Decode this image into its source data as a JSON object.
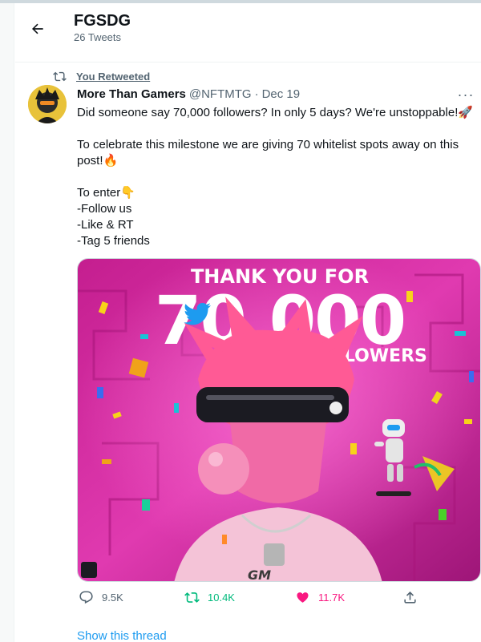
{
  "header": {
    "name": "FGSDG",
    "tweet_count": "26 Tweets"
  },
  "tweet": {
    "retweet_label": "You Retweeted",
    "author_name": "More Than Gamers",
    "author_handle": "@NFTMTG",
    "separator": "·",
    "date": "Dec 19",
    "more_label": "···",
    "text_lines": [
      "Did someone say 70,000 followers? In only 5 days? We're unstoppable!🚀",
      "",
      "To celebrate this milestone we are giving 70 whitelist spots away on this post!🔥",
      "",
      "To enter👇",
      "-Follow us",
      "-Like & RT",
      "-Tag 5 friends"
    ],
    "media": {
      "headline": "THANK YOU FOR",
      "big_number": "70,000",
      "subline": "FOLLOWERS",
      "badge": "GM"
    },
    "actions": {
      "replies": "9.5K",
      "retweets": "10.4K",
      "likes": "11.7K"
    },
    "show_thread": "Show this thread"
  },
  "colors": {
    "accent": "#1d9bf0",
    "retweet": "#00ba7c",
    "like": "#f91880",
    "muted": "#536471",
    "media_bg": "#d42a9c"
  },
  "icons": {
    "back": "arrow-left-icon",
    "retweet": "retweet-icon",
    "reply": "reply-bubble-icon",
    "like": "heart-filled-icon",
    "share": "share-upload-icon",
    "more": "more-dots-icon",
    "bird": "twitter-bird-icon"
  }
}
